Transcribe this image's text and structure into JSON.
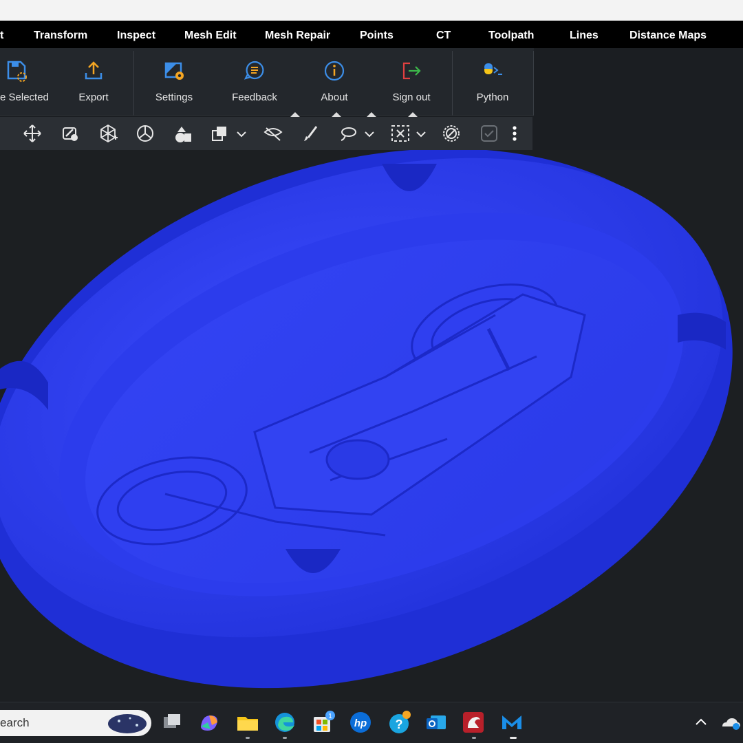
{
  "menu": {
    "items": [
      "t",
      "Transform",
      "Inspect",
      "Mesh Edit",
      "Mesh Repair",
      "Points",
      "CT",
      "Toolpath",
      "Lines",
      "Distance Maps"
    ]
  },
  "ribbon": {
    "save_selected": "e Selected",
    "export": "Export",
    "settings": "Settings",
    "feedback": "Feedback",
    "about": "About",
    "sign_out": "Sign out",
    "python": "Python"
  },
  "toolbar": {
    "tools": [
      "move-icon",
      "select-object-icon",
      "transform-icon",
      "mercedes-icon",
      "shapes-icon",
      "copy-icon",
      "hide-icon",
      "brush-icon",
      "lasso-icon",
      "box-select-icon",
      "deselect-icon",
      "checkbox-icon",
      "more-icon"
    ]
  },
  "taskbar": {
    "search_text": "earch",
    "store_badge": "1"
  },
  "colors": {
    "mesh": "#2b3bf0",
    "menubar": "#000000",
    "ribbon": "#23272c",
    "accent": "#3c8ee8"
  }
}
